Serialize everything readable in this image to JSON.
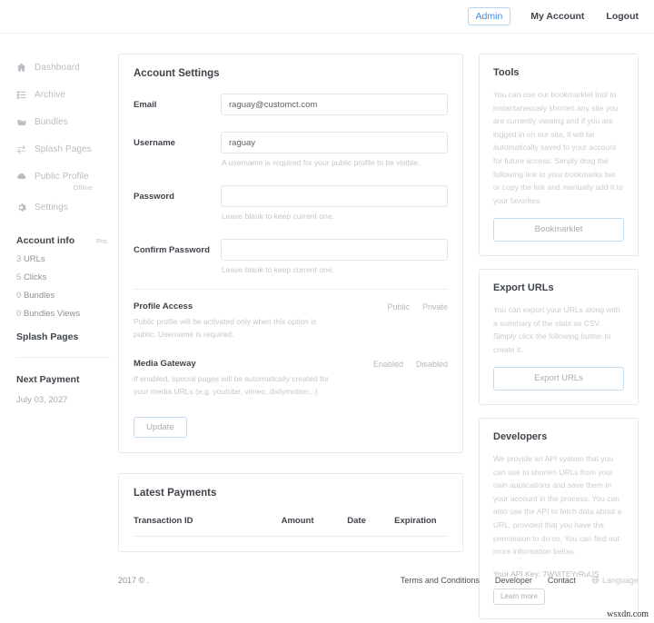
{
  "topnav": {
    "admin": "Admin",
    "my_account": "My Account",
    "logout": "Logout",
    "accent_color": "#3f8ae0"
  },
  "sidebar": {
    "items": [
      {
        "label": "Dashboard",
        "icon": "home-icon"
      },
      {
        "label": "Archive",
        "icon": "list-icon"
      },
      {
        "label": "Bundles",
        "icon": "folder-icon"
      },
      {
        "label": "Splash Pages",
        "icon": "exchange-icon"
      },
      {
        "label": "Public Profile",
        "icon": "cloud-icon",
        "status": "Offline"
      },
      {
        "label": "Settings",
        "icon": "gear-icon"
      }
    ],
    "account_info": {
      "title": "Account info",
      "badge": "Pro"
    },
    "stats": [
      {
        "num": "3",
        "label": "URLs"
      },
      {
        "num": "5",
        "label": "Clicks"
      },
      {
        "num": "0",
        "label": "Bundles"
      },
      {
        "num": "0",
        "label": "Bundles Views"
      }
    ],
    "splash_pages": "Splash Pages",
    "next_payment": {
      "title": "Next Payment",
      "date": "July 03, 2027"
    }
  },
  "account_settings": {
    "title": "Account Settings",
    "email": {
      "label": "Email",
      "value": "raguay@customct.com"
    },
    "username": {
      "label": "Username",
      "value": "raguay",
      "hint": "A username is required for your public profile to be visible."
    },
    "password": {
      "label": "Password",
      "value": "",
      "hint": "Leave blank to keep current one."
    },
    "confirm_password": {
      "label": "Confirm Password",
      "value": "",
      "hint": "Leave blank to keep current one."
    },
    "profile_access": {
      "title": "Profile Access",
      "desc": "Public profile will be activated only when this option is public. Username is required.",
      "options": [
        "Public",
        "Private"
      ]
    },
    "media_gateway": {
      "title": "Media Gateway",
      "desc": "If enabled, special pages will be automatically created for your media URLs (e.g. youtube, vimeo, dailymotion...)",
      "options": [
        "Enabled",
        "Disabled"
      ]
    },
    "update_button": "Update"
  },
  "latest_payments": {
    "title": "Latest Payments",
    "columns": [
      "Transaction ID",
      "Amount",
      "Date",
      "Expiration"
    ],
    "rows": []
  },
  "tools": {
    "title": "Tools",
    "text": "You can use our bookmarklet tool to instantaneously shorten any site you are currently viewing and if you are logged in on our site, it will be automatically saved to your account for future access. Simply drag the following link to your bookmarks bar or copy the link and manually add it to your favorites.",
    "button": "Bookmarklet"
  },
  "export_urls": {
    "title": "Export URLs",
    "text": "You can export your URLs along with a summary of the stats as CSV. Simply click the following button to create it.",
    "button": "Export URLs"
  },
  "developers": {
    "title": "Developers",
    "text": "We provide an API system that you can use to shorten URLs from your own applications and save them in your account in the process. You can also use the API to fetch data about a URL, provided that you have the permission to do so. You can find out more information below.",
    "api_key": "Your API Key: 7WViTEYrRuUS",
    "button": "Learn more"
  },
  "footer": {
    "copyright": "2017 © .",
    "links": [
      "Terms and Conditions",
      "Developer",
      "Contact"
    ],
    "language": "Language"
  },
  "watermark": "wsxdn.com"
}
